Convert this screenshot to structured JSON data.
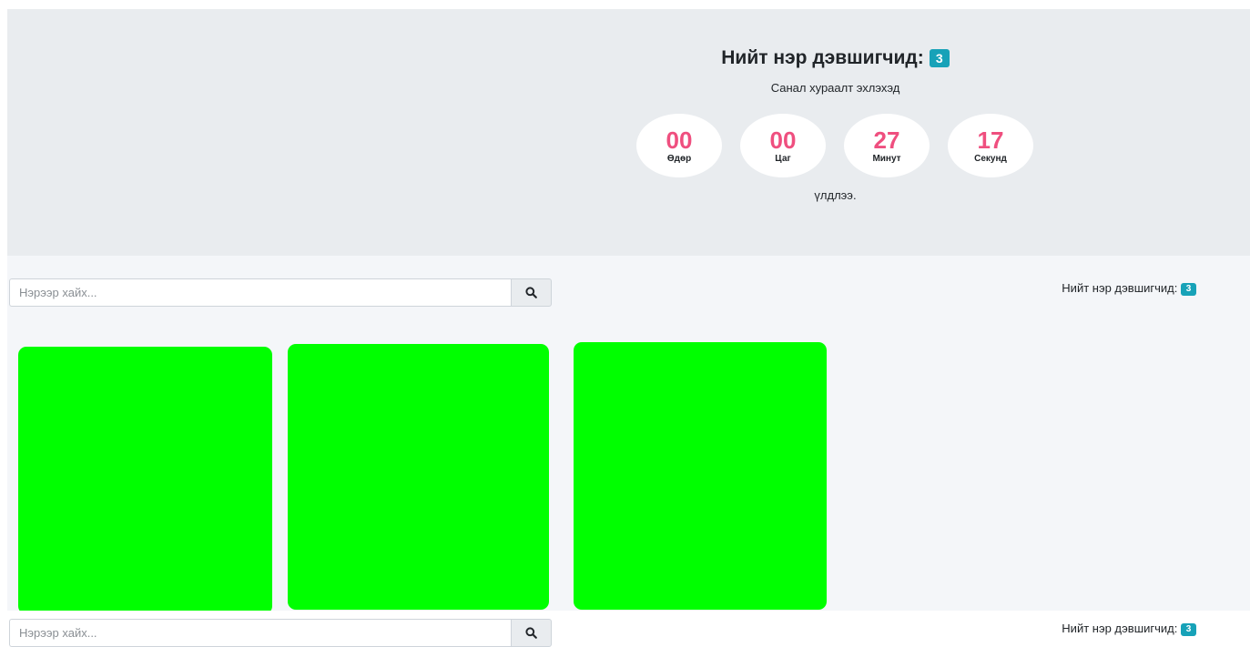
{
  "hero": {
    "title": "Нийт нэр дэвшигчид:",
    "count": "3",
    "subtitle": "Санал хураалт эхлэхэд",
    "countdown": [
      {
        "value": "00",
        "label": "Өдөр"
      },
      {
        "value": "00",
        "label": "Цаг"
      },
      {
        "value": "27",
        "label": "Минут"
      },
      {
        "value": "17",
        "label": "Секунд"
      }
    ],
    "remaining": "үлдлээ."
  },
  "search": {
    "placeholder": "Нэрээр хайх..."
  },
  "total": {
    "label": "Нийт нэр дэвшигчид:",
    "count": "3"
  },
  "colors": {
    "accent": "#17a2b8",
    "countdown_number": "#ef4f7f",
    "card": "#00ff00",
    "hero_bg": "#e9ecef",
    "content_bg": "#f4f6f9"
  },
  "icons": {
    "search": "search-icon"
  }
}
